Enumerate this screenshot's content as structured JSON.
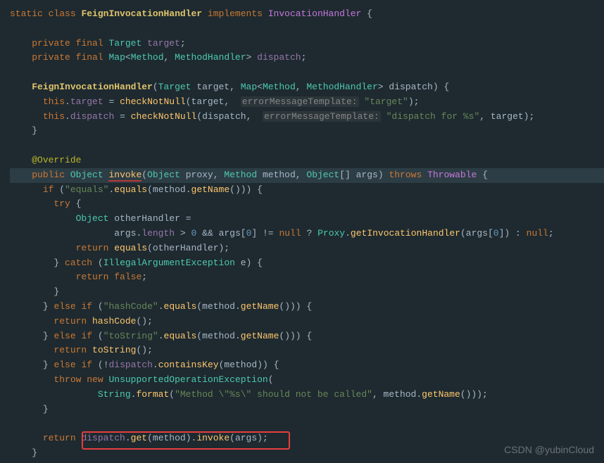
{
  "watermark": "CSDN @yubinCloud",
  "code": {
    "l01": {
      "static": "static",
      "class": "class",
      "FeignInvocationHandler": "FeignInvocationHandler",
      "implements": "implements",
      "InvocationHandler": "InvocationHandler"
    },
    "l03": {
      "private": "private",
      "final": "final",
      "Target": "Target",
      "target": "target"
    },
    "l04": {
      "private": "private",
      "final": "final",
      "Map": "Map",
      "Method": "Method",
      "MethodHandler": "MethodHandler",
      "dispatch": "dispatch"
    },
    "l06": {
      "ctor": "FeignInvocationHandler",
      "Target": "Target",
      "target": "target",
      "Map": "Map",
      "Method": "Method",
      "MethodHandler": "MethodHandler",
      "dispatch": "dispatch"
    },
    "l07": {
      "this": "this",
      "target": "target",
      "checkNotNull": "checkNotNull",
      "arg1": "target",
      "hint": "errorMessageTemplate:",
      "str": "\"target\""
    },
    "l08": {
      "this": "this",
      "dispatch": "dispatch",
      "checkNotNull": "checkNotNull",
      "arg1": "dispatch",
      "hint": "errorMessageTemplate:",
      "str": "\"dispatch for %s\"",
      "target": "target"
    },
    "l11": {
      "Override": "@Override"
    },
    "l12": {
      "public": "public",
      "Object": "Object",
      "invoke": "invoke",
      "proxy": "proxy",
      "Method": "Method",
      "method": "method",
      "args": "args",
      "throws": "throws",
      "Throwable": "Throwable"
    },
    "l13": {
      "if": "if",
      "str": "\"equals\"",
      "equals": "equals",
      "method": "method",
      "getName": "getName"
    },
    "l14": {
      "try": "try"
    },
    "l15": {
      "Object": "Object",
      "otherHandler": "otherHandler"
    },
    "l16": {
      "args": "args",
      "length": "length",
      "zero": "0",
      "null": "null",
      "Proxy": "Proxy",
      "getInvocationHandler": "getInvocationHandler",
      "trail_null": "null"
    },
    "l17": {
      "return": "return",
      "equals": "equals",
      "otherHandler": "otherHandler"
    },
    "l18": {
      "catch": "catch",
      "IllegalArgumentException": "IllegalArgumentException",
      "e": "e"
    },
    "l19": {
      "return": "return",
      "false": "false"
    },
    "l21": {
      "else": "else",
      "if": "if",
      "str": "\"hashCode\"",
      "equals": "equals",
      "method": "method",
      "getName": "getName"
    },
    "l22": {
      "return": "return",
      "hashCode": "hashCode"
    },
    "l23": {
      "else": "else",
      "if": "if",
      "str": "\"toString\"",
      "equals": "equals",
      "method": "method",
      "getName": "getName"
    },
    "l24": {
      "return": "return",
      "toString": "toString"
    },
    "l25": {
      "else": "else",
      "if": "if",
      "dispatch": "dispatch",
      "containsKey": "containsKey",
      "method": "method"
    },
    "l26": {
      "throw": "throw",
      "new": "new",
      "UnsupportedOperationException": "UnsupportedOperationException"
    },
    "l27": {
      "String": "String",
      "format": "format",
      "str": "\"Method \\\"%s\\\" should not be called\"",
      "method": "method",
      "getName": "getName"
    },
    "l30": {
      "return": "return",
      "dispatch": "dispatch",
      "get": "get",
      "method": "method",
      "invoke": "invoke",
      "args": "args"
    }
  }
}
